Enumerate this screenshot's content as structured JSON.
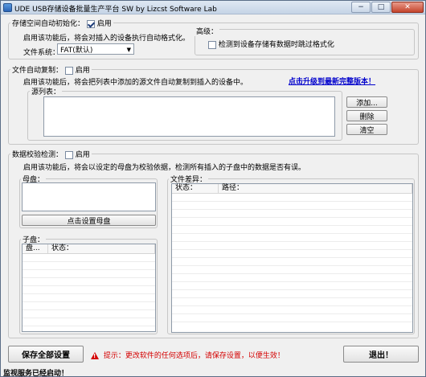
{
  "window": {
    "title": "UDE USB存储设备批量生产平台 SW    by Lizcst Software Lab",
    "min": "−",
    "max": "□",
    "close": "✕"
  },
  "format": {
    "legend": "存储空间自动初始化：",
    "enable_label": "启用",
    "enabled": true,
    "description": "启用该功能后，将会对插入的设备执行自动格式化。",
    "filesystem_label": "文件系统：",
    "filesystem_value": "FAT(默认)",
    "advanced_legend": "高级：",
    "advanced_option": "检测到设备存储有数据时跳过格式化",
    "advanced_checked": false
  },
  "copy": {
    "legend": "文件自动复制：",
    "enable_label": "启用",
    "enabled": false,
    "description": "启用该功能后，将会把列表中添加的源文件自动复制到插入的设备中。",
    "upgrade_link": "点击升级到最新完整版本！",
    "source_label": "源列表：",
    "add_button": "添加...",
    "delete_button": "删除",
    "clear_button": "清空"
  },
  "verify": {
    "legend": "数据校验检测：",
    "enable_label": "启用",
    "enabled": false,
    "description": "启用该功能后，将会以设定的母盘为校验依据，检测所有插入的子盘中的数据是否有误。",
    "master_legend": "母盘：",
    "set_master_button": "点击设置母盘",
    "child_legend": "子盘：",
    "child_columns": [
      "盘...",
      "状态："
    ],
    "diff_legend": "文件差异：",
    "diff_columns": [
      "状态：",
      "路径："
    ]
  },
  "footer": {
    "save_all": "保存全部设置",
    "tip": "提示：更改软件的任何选项后，请保存设置，以便生效！",
    "exit": "退出！",
    "status": "监视服务已经启动！"
  }
}
